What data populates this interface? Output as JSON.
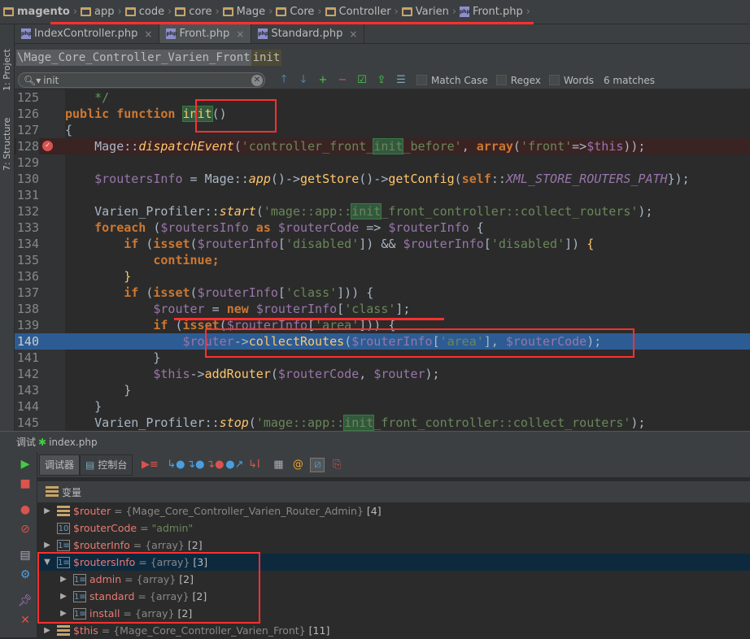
{
  "breadcrumb": [
    "magento",
    "app",
    "code",
    "core",
    "Mage",
    "Core",
    "Controller",
    "Varien",
    "Front.php"
  ],
  "tabs": [
    {
      "label": "IndexController.php",
      "active": false
    },
    {
      "label": "Front.php",
      "active": true
    },
    {
      "label": "Standard.php",
      "active": false
    }
  ],
  "side": {
    "project": "1: Project",
    "structure": "7: Structure"
  },
  "nav": {
    "class": "\\Mage_Core_Controller_Varien_Front",
    "method": "init"
  },
  "search": {
    "value": "init",
    "match_case": "Match Case",
    "regex": "Regex",
    "words": "Words",
    "matches": "6 matches"
  },
  "code": [
    {
      "n": "125",
      "t": [
        [
          "c",
          "    */"
        ]
      ]
    },
    {
      "n": "126",
      "t": [
        [
          "k",
          "public function "
        ],
        [
          "fm",
          "init"
        ],
        [
          "",
          "()"
        ]
      ]
    },
    {
      "n": "127",
      "t": [
        [
          "",
          "{"
        ]
      ]
    },
    {
      "n": "128",
      "bp": true,
      "t": [
        [
          "",
          "    Mage::"
        ],
        [
          "fi",
          "dispatchEvent"
        ],
        [
          "",
          "("
        ],
        [
          "s",
          "'controller_front_"
        ],
        [
          "sm",
          "init"
        ],
        [
          "s",
          "_before'"
        ],
        [
          "",
          ", "
        ],
        [
          "k",
          "array"
        ],
        [
          "",
          "("
        ],
        [
          "s",
          "'front'"
        ],
        [
          "",
          "=>"
        ],
        [
          "v",
          "$this"
        ],
        [
          "",
          "));"
        ]
      ]
    },
    {
      "n": "129",
      "t": []
    },
    {
      "n": "130",
      "t": [
        [
          "v",
          "    $routersInfo"
        ],
        [
          "",
          " = Mage::"
        ],
        [
          "fi",
          "app"
        ],
        [
          "",
          "()->"
        ],
        [
          "f",
          "getStore"
        ],
        [
          "",
          "()->"
        ],
        [
          "f",
          "getConfig"
        ],
        [
          "",
          "("
        ],
        [
          "k",
          "self"
        ],
        [
          "",
          "::"
        ],
        [
          "ci",
          "XML_STORE_ROUTERS_PATH"
        ],
        [
          "",
          "});"
        ]
      ]
    },
    {
      "n": "131",
      "t": []
    },
    {
      "n": "132",
      "t": [
        [
          "",
          "    Varien_Profiler::"
        ],
        [
          "fi",
          "start"
        ],
        [
          "",
          "("
        ],
        [
          "s",
          "'mage::app::"
        ],
        [
          "sm",
          "init"
        ],
        [
          "s",
          "_front_controller::collect_routers'"
        ],
        [
          "",
          ");"
        ]
      ]
    },
    {
      "n": "133",
      "t": [
        [
          "k",
          "    foreach"
        ],
        [
          "",
          " ("
        ],
        [
          "v",
          "$routersInfo"
        ],
        [
          "k",
          " as "
        ],
        [
          "v",
          "$routerCode"
        ],
        [
          "",
          " => "
        ],
        [
          "v",
          "$routerInfo"
        ],
        [
          "",
          " {"
        ]
      ]
    },
    {
      "n": "134",
      "t": [
        [
          "k",
          "        if"
        ],
        [
          "",
          " ("
        ],
        [
          "k",
          "isset"
        ],
        [
          "",
          "("
        ],
        [
          "v",
          "$routerInfo"
        ],
        [
          "",
          "["
        ],
        [
          "s",
          "'disabled'"
        ],
        [
          "",
          "]) && "
        ],
        [
          "v",
          "$routerInfo"
        ],
        [
          "",
          "["
        ],
        [
          "s",
          "'disabled'"
        ],
        [
          "",
          "]) "
        ],
        [
          "f",
          "{"
        ]
      ]
    },
    {
      "n": "135",
      "t": [
        [
          "k",
          "            continue"
        ],
        [
          "k",
          ";"
        ]
      ]
    },
    {
      "n": "136",
      "t": [
        [
          "f",
          "        }"
        ]
      ]
    },
    {
      "n": "137",
      "t": [
        [
          "k",
          "        if"
        ],
        [
          "",
          " ("
        ],
        [
          "k",
          "isset"
        ],
        [
          "",
          "("
        ],
        [
          "v",
          "$routerInfo"
        ],
        [
          "",
          "["
        ],
        [
          "s",
          "'class'"
        ],
        [
          "",
          "])) {"
        ]
      ]
    },
    {
      "n": "138",
      "t": [
        [
          "v",
          "            $router"
        ],
        [
          "",
          " = "
        ],
        [
          "k",
          "new "
        ],
        [
          "v",
          "$routerInfo"
        ],
        [
          "",
          "["
        ],
        [
          "s",
          "'class'"
        ],
        [
          "",
          "];"
        ]
      ]
    },
    {
      "n": "139",
      "t": [
        [
          "k",
          "            if"
        ],
        [
          "",
          " ("
        ],
        [
          "k",
          "isset"
        ],
        [
          "",
          "("
        ],
        [
          "v",
          "$routerInfo"
        ],
        [
          "",
          "["
        ],
        [
          "s",
          "'area'"
        ],
        [
          "",
          "])) {"
        ]
      ]
    },
    {
      "n": "140",
      "cur": true,
      "t": [
        [
          "v",
          "                $router"
        ],
        [
          "",
          "->"
        ],
        [
          "f",
          "collectRoutes"
        ],
        [
          "",
          "("
        ],
        [
          "v",
          "$routerInfo"
        ],
        [
          "",
          "["
        ],
        [
          "s",
          "'area'"
        ],
        [
          "",
          "], "
        ],
        [
          "v",
          "$routerCode"
        ],
        [
          "",
          ");"
        ]
      ]
    },
    {
      "n": "141",
      "t": [
        [
          "",
          "            }"
        ]
      ]
    },
    {
      "n": "142",
      "t": [
        [
          "v",
          "            $this"
        ],
        [
          "",
          "->"
        ],
        [
          "f",
          "addRouter"
        ],
        [
          "",
          "("
        ],
        [
          "v",
          "$routerCode"
        ],
        [
          "",
          ", "
        ],
        [
          "v",
          "$router"
        ],
        [
          "",
          ");"
        ]
      ]
    },
    {
      "n": "143",
      "t": [
        [
          "",
          "        }"
        ]
      ]
    },
    {
      "n": "144",
      "t": [
        [
          "",
          "    }"
        ]
      ]
    },
    {
      "n": "145",
      "t": [
        [
          "",
          "    Varien_Profiler::"
        ],
        [
          "fi",
          "stop"
        ],
        [
          "",
          "("
        ],
        [
          "s",
          "'mage::app::"
        ],
        [
          "sm",
          "init"
        ],
        [
          "s",
          "_front_controller::collect_routers'"
        ],
        [
          "",
          ");"
        ]
      ]
    }
  ],
  "debug": {
    "title_prefix": "调试",
    "title_file": "index.php",
    "tab_debugger": "调试器",
    "tab_console": "控制台",
    "variables_label": "变量"
  },
  "variables": [
    {
      "name": "$router",
      "type": "{Mage_Core_Controller_Varien_Router_Admin}",
      "count": "[4]",
      "level": 0,
      "expand": "collapsed",
      "icon": "object"
    },
    {
      "name": "$routerCode",
      "string": "\"admin\"",
      "level": 0,
      "expand": "none",
      "icon": "string"
    },
    {
      "name": "$routerInfo",
      "type": "{array}",
      "count": "[2]",
      "level": 0,
      "expand": "collapsed",
      "icon": "array"
    },
    {
      "name": "$routersInfo",
      "type": "{array}",
      "count": "[3]",
      "level": 0,
      "expand": "expanded",
      "icon": "array",
      "selected": true
    },
    {
      "name": "admin",
      "type": "{array}",
      "count": "[2]",
      "level": 1,
      "expand": "collapsed",
      "icon": "array"
    },
    {
      "name": "standard",
      "type": "{array}",
      "count": "[2]",
      "level": 1,
      "expand": "collapsed",
      "icon": "array"
    },
    {
      "name": "install",
      "type": "{array}",
      "count": "[2]",
      "level": 1,
      "expand": "collapsed",
      "icon": "array"
    },
    {
      "name": "$this",
      "type": "{Mage_Core_Controller_Varien_Front}",
      "count": "[11]",
      "level": 0,
      "expand": "collapsed",
      "icon": "object"
    }
  ],
  "colors": {
    "annotation": "#ff3030",
    "keyword": "#cc7832",
    "variable": "#9876aa",
    "string": "#6a8759",
    "function": "#ffc66d",
    "current_line": "#2d5c94"
  }
}
